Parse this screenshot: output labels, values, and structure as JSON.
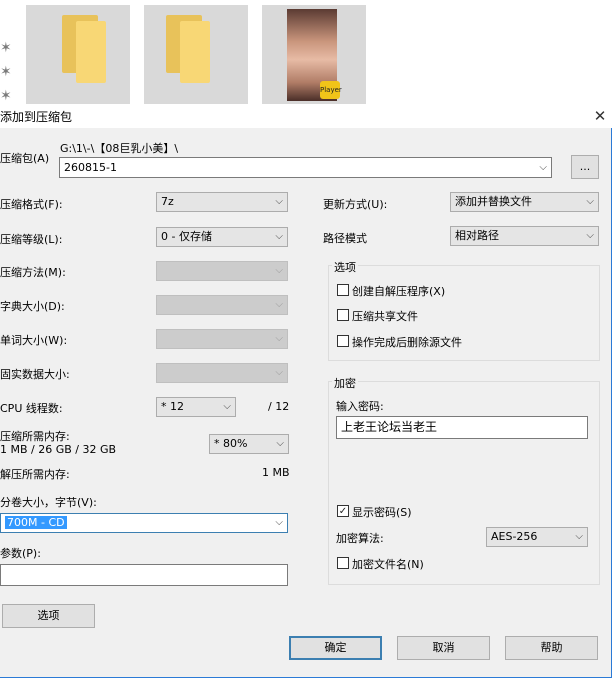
{
  "dialog": {
    "title": "添加到压缩包",
    "archive_label": "压缩包(A)",
    "archive_path": "G:\\1\\-\\【08巨乳小美】\\",
    "archive_name": "260815-1",
    "browse_label": "...",
    "left": {
      "format_label": "压缩格式(F):",
      "format_value": "7z",
      "level_label": "压缩等级(L):",
      "level_value": "0 - 仅存储",
      "method_label": "压缩方法(M):",
      "dict_label": "字典大小(D):",
      "word_label": "单词大小(W):",
      "solid_label": "固实数据大小:",
      "threads_label": "CPU 线程数:",
      "threads_value": "* 12",
      "threads_total": "/ 12",
      "mem_compress_label": "压缩所需内存:",
      "mem_compress_detail": "1 MB / 26 GB / 32 GB",
      "mem_percent": "* 80%",
      "mem_decompress_label": "解压所需内存:",
      "mem_decompress_value": "1 MB",
      "volume_label": "分卷大小，字节(V):",
      "volume_value": "700M - CD",
      "params_label": "参数(P):",
      "params_value": "",
      "options_button": "选项"
    },
    "right": {
      "update_label": "更新方式(U):",
      "update_value": "添加并替换文件",
      "path_label": "路径模式",
      "path_value": "相对路径",
      "options_group": "选项",
      "opt_sfx": "创建自解压程序(X)",
      "opt_shared": "压缩共享文件",
      "opt_delete": "操作完成后删除源文件",
      "encrypt_group": "加密",
      "password_label": "输入密码:",
      "password_value": "上老王论坛当老王",
      "show_password": "显示密码(S)",
      "show_password_checked": true,
      "enc_method_label": "加密算法:",
      "enc_method_value": "AES-256",
      "encrypt_names": "加密文件名(N)"
    },
    "buttons": {
      "ok": "确定",
      "cancel": "取消",
      "help": "帮助"
    }
  },
  "background": {
    "badge_text": "Player"
  },
  "colors": {
    "accent": "#2b7ad6",
    "selection": "#3399ff",
    "dialog_bg": "#f0f0f0"
  },
  "icons": {
    "close": "close-icon",
    "dropdown": "chevron-down-icon",
    "checkbox": "checkbox-icon",
    "folder": "folder-icon"
  }
}
